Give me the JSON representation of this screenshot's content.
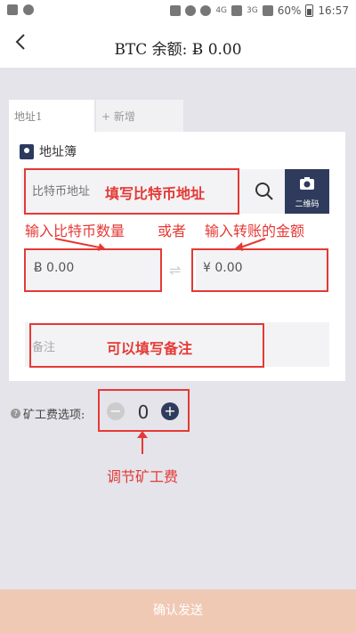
{
  "statusbar": {
    "signal_tag": "4G",
    "signal_tag2": "3G",
    "battery": "60%",
    "time": "16:57"
  },
  "header": {
    "back_icon": "chevron-left-icon",
    "title": "BTC 余额: Ƀ 0.00"
  },
  "tabs": [
    {
      "label": "地址1"
    },
    {
      "label": "+ 新增"
    }
  ],
  "address_book": {
    "label": "地址簿"
  },
  "address_input": {
    "placeholder": "比特币地址"
  },
  "qr_button": {
    "label": "二维码"
  },
  "amount_btc": {
    "value": "Ƀ 0.00"
  },
  "amount_cny": {
    "value": "¥ 0.00"
  },
  "note": {
    "placeholder": "备注"
  },
  "fee": {
    "label": "矿工费选项:",
    "value": "0"
  },
  "annotations": {
    "address": "填写比特币地址",
    "btc_amount": "输入比特币数量",
    "or": "或者",
    "cny_amount": "输入转账的金额",
    "note": "可以填写备注",
    "fee": "调节矿工费"
  },
  "confirm_button": {
    "label": "确认发送"
  },
  "colors": {
    "accent": "#2f3b5d",
    "annotation": "#e53935",
    "confirm_bg": "#f0c9b5",
    "page_bg": "#e4e4ea"
  }
}
